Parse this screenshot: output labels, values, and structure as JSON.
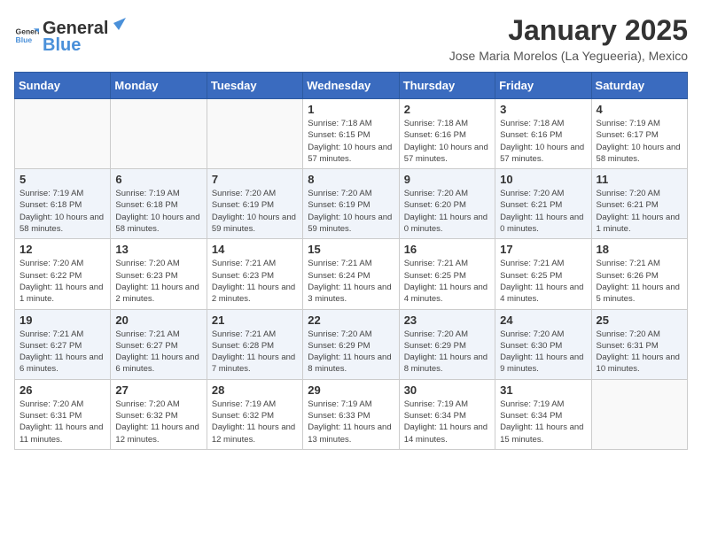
{
  "header": {
    "logo_general": "General",
    "logo_blue": "Blue",
    "title": "January 2025",
    "subtitle": "Jose Maria Morelos (La Yegueeria), Mexico"
  },
  "weekdays": [
    "Sunday",
    "Monday",
    "Tuesday",
    "Wednesday",
    "Thursday",
    "Friday",
    "Saturday"
  ],
  "weeks": [
    [
      {
        "day": "",
        "sunrise": "",
        "sunset": "",
        "daylight": "",
        "empty": true
      },
      {
        "day": "",
        "sunrise": "",
        "sunset": "",
        "daylight": "",
        "empty": true
      },
      {
        "day": "",
        "sunrise": "",
        "sunset": "",
        "daylight": "",
        "empty": true
      },
      {
        "day": "1",
        "sunrise": "Sunrise: 7:18 AM",
        "sunset": "Sunset: 6:15 PM",
        "daylight": "Daylight: 10 hours and 57 minutes."
      },
      {
        "day": "2",
        "sunrise": "Sunrise: 7:18 AM",
        "sunset": "Sunset: 6:16 PM",
        "daylight": "Daylight: 10 hours and 57 minutes."
      },
      {
        "day": "3",
        "sunrise": "Sunrise: 7:18 AM",
        "sunset": "Sunset: 6:16 PM",
        "daylight": "Daylight: 10 hours and 57 minutes."
      },
      {
        "day": "4",
        "sunrise": "Sunrise: 7:19 AM",
        "sunset": "Sunset: 6:17 PM",
        "daylight": "Daylight: 10 hours and 58 minutes."
      }
    ],
    [
      {
        "day": "5",
        "sunrise": "Sunrise: 7:19 AM",
        "sunset": "Sunset: 6:18 PM",
        "daylight": "Daylight: 10 hours and 58 minutes."
      },
      {
        "day": "6",
        "sunrise": "Sunrise: 7:19 AM",
        "sunset": "Sunset: 6:18 PM",
        "daylight": "Daylight: 10 hours and 58 minutes."
      },
      {
        "day": "7",
        "sunrise": "Sunrise: 7:20 AM",
        "sunset": "Sunset: 6:19 PM",
        "daylight": "Daylight: 10 hours and 59 minutes."
      },
      {
        "day": "8",
        "sunrise": "Sunrise: 7:20 AM",
        "sunset": "Sunset: 6:19 PM",
        "daylight": "Daylight: 10 hours and 59 minutes."
      },
      {
        "day": "9",
        "sunrise": "Sunrise: 7:20 AM",
        "sunset": "Sunset: 6:20 PM",
        "daylight": "Daylight: 11 hours and 0 minutes."
      },
      {
        "day": "10",
        "sunrise": "Sunrise: 7:20 AM",
        "sunset": "Sunset: 6:21 PM",
        "daylight": "Daylight: 11 hours and 0 minutes."
      },
      {
        "day": "11",
        "sunrise": "Sunrise: 7:20 AM",
        "sunset": "Sunset: 6:21 PM",
        "daylight": "Daylight: 11 hours and 1 minute."
      }
    ],
    [
      {
        "day": "12",
        "sunrise": "Sunrise: 7:20 AM",
        "sunset": "Sunset: 6:22 PM",
        "daylight": "Daylight: 11 hours and 1 minute."
      },
      {
        "day": "13",
        "sunrise": "Sunrise: 7:20 AM",
        "sunset": "Sunset: 6:23 PM",
        "daylight": "Daylight: 11 hours and 2 minutes."
      },
      {
        "day": "14",
        "sunrise": "Sunrise: 7:21 AM",
        "sunset": "Sunset: 6:23 PM",
        "daylight": "Daylight: 11 hours and 2 minutes."
      },
      {
        "day": "15",
        "sunrise": "Sunrise: 7:21 AM",
        "sunset": "Sunset: 6:24 PM",
        "daylight": "Daylight: 11 hours and 3 minutes."
      },
      {
        "day": "16",
        "sunrise": "Sunrise: 7:21 AM",
        "sunset": "Sunset: 6:25 PM",
        "daylight": "Daylight: 11 hours and 4 minutes."
      },
      {
        "day": "17",
        "sunrise": "Sunrise: 7:21 AM",
        "sunset": "Sunset: 6:25 PM",
        "daylight": "Daylight: 11 hours and 4 minutes."
      },
      {
        "day": "18",
        "sunrise": "Sunrise: 7:21 AM",
        "sunset": "Sunset: 6:26 PM",
        "daylight": "Daylight: 11 hours and 5 minutes."
      }
    ],
    [
      {
        "day": "19",
        "sunrise": "Sunrise: 7:21 AM",
        "sunset": "Sunset: 6:27 PM",
        "daylight": "Daylight: 11 hours and 6 minutes."
      },
      {
        "day": "20",
        "sunrise": "Sunrise: 7:21 AM",
        "sunset": "Sunset: 6:27 PM",
        "daylight": "Daylight: 11 hours and 6 minutes."
      },
      {
        "day": "21",
        "sunrise": "Sunrise: 7:21 AM",
        "sunset": "Sunset: 6:28 PM",
        "daylight": "Daylight: 11 hours and 7 minutes."
      },
      {
        "day": "22",
        "sunrise": "Sunrise: 7:20 AM",
        "sunset": "Sunset: 6:29 PM",
        "daylight": "Daylight: 11 hours and 8 minutes."
      },
      {
        "day": "23",
        "sunrise": "Sunrise: 7:20 AM",
        "sunset": "Sunset: 6:29 PM",
        "daylight": "Daylight: 11 hours and 8 minutes."
      },
      {
        "day": "24",
        "sunrise": "Sunrise: 7:20 AM",
        "sunset": "Sunset: 6:30 PM",
        "daylight": "Daylight: 11 hours and 9 minutes."
      },
      {
        "day": "25",
        "sunrise": "Sunrise: 7:20 AM",
        "sunset": "Sunset: 6:31 PM",
        "daylight": "Daylight: 11 hours and 10 minutes."
      }
    ],
    [
      {
        "day": "26",
        "sunrise": "Sunrise: 7:20 AM",
        "sunset": "Sunset: 6:31 PM",
        "daylight": "Daylight: 11 hours and 11 minutes."
      },
      {
        "day": "27",
        "sunrise": "Sunrise: 7:20 AM",
        "sunset": "Sunset: 6:32 PM",
        "daylight": "Daylight: 11 hours and 12 minutes."
      },
      {
        "day": "28",
        "sunrise": "Sunrise: 7:19 AM",
        "sunset": "Sunset: 6:32 PM",
        "daylight": "Daylight: 11 hours and 12 minutes."
      },
      {
        "day": "29",
        "sunrise": "Sunrise: 7:19 AM",
        "sunset": "Sunset: 6:33 PM",
        "daylight": "Daylight: 11 hours and 13 minutes."
      },
      {
        "day": "30",
        "sunrise": "Sunrise: 7:19 AM",
        "sunset": "Sunset: 6:34 PM",
        "daylight": "Daylight: 11 hours and 14 minutes."
      },
      {
        "day": "31",
        "sunrise": "Sunrise: 7:19 AM",
        "sunset": "Sunset: 6:34 PM",
        "daylight": "Daylight: 11 hours and 15 minutes."
      },
      {
        "day": "",
        "sunrise": "",
        "sunset": "",
        "daylight": "",
        "empty": true
      }
    ]
  ]
}
